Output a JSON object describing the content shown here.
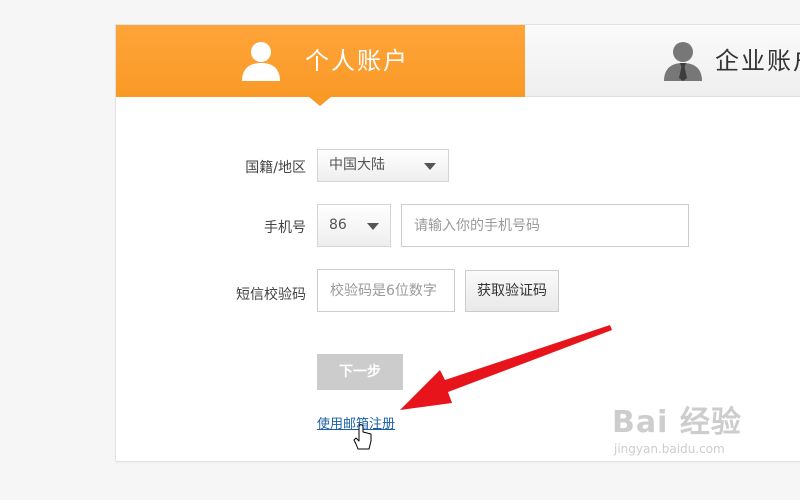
{
  "tabs": {
    "personal": {
      "label": "个人账户",
      "icon": "user-icon",
      "active": true
    },
    "business": {
      "label": "企业账户",
      "icon": "business-user-icon",
      "active": false
    }
  },
  "form": {
    "nationality": {
      "label": "国籍/地区",
      "value": "中国大陆"
    },
    "phone": {
      "label": "手机号",
      "country_code": "86",
      "placeholder": "请输入你的手机号码"
    },
    "sms_code": {
      "label": "短信校验码",
      "placeholder": "校验码是6位数字",
      "get_code_button": "获取验证码"
    },
    "next_button": "下一步",
    "email_register_link": "使用邮箱注册"
  },
  "watermark": {
    "logo_text": "Bai 经验",
    "url": "jingyan.baidu.com"
  },
  "colors": {
    "accent": "#f99a27",
    "annotation_arrow": "#e8141b",
    "link": "#1a5fa8",
    "disabled_button": "#cccccc"
  }
}
